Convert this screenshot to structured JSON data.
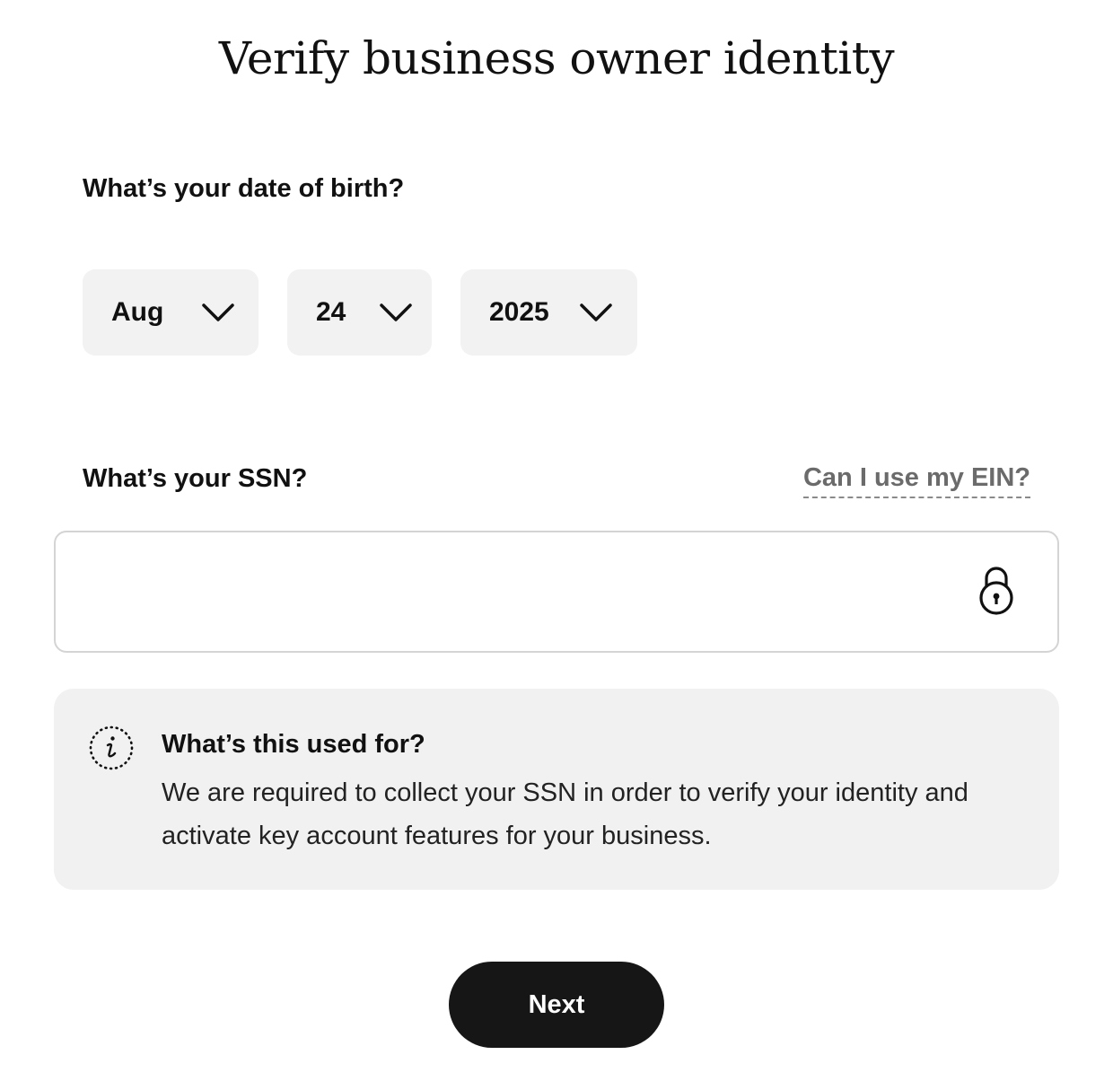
{
  "header": {
    "title": "Verify business owner identity"
  },
  "dob": {
    "label": "What’s your date of birth?",
    "month": "Aug",
    "day": "24",
    "year": "2025"
  },
  "ssn": {
    "label": "What’s your SSN?",
    "ein_link": "Can I use my EIN?",
    "value": "",
    "placeholder": ""
  },
  "info": {
    "title": "What’s this used for?",
    "body": "We are required to collect your SSN in order to verify your identity and activate key account features for your business."
  },
  "actions": {
    "next_label": "Next"
  },
  "icons": {
    "chevron": "chevron-down-icon",
    "lock": "lock-icon",
    "info": "info-icon"
  },
  "colors": {
    "primary_button": "#161616",
    "select_bg": "#f2f2f2",
    "info_bg": "#f0f1f0",
    "link": "#6b6b6b"
  }
}
